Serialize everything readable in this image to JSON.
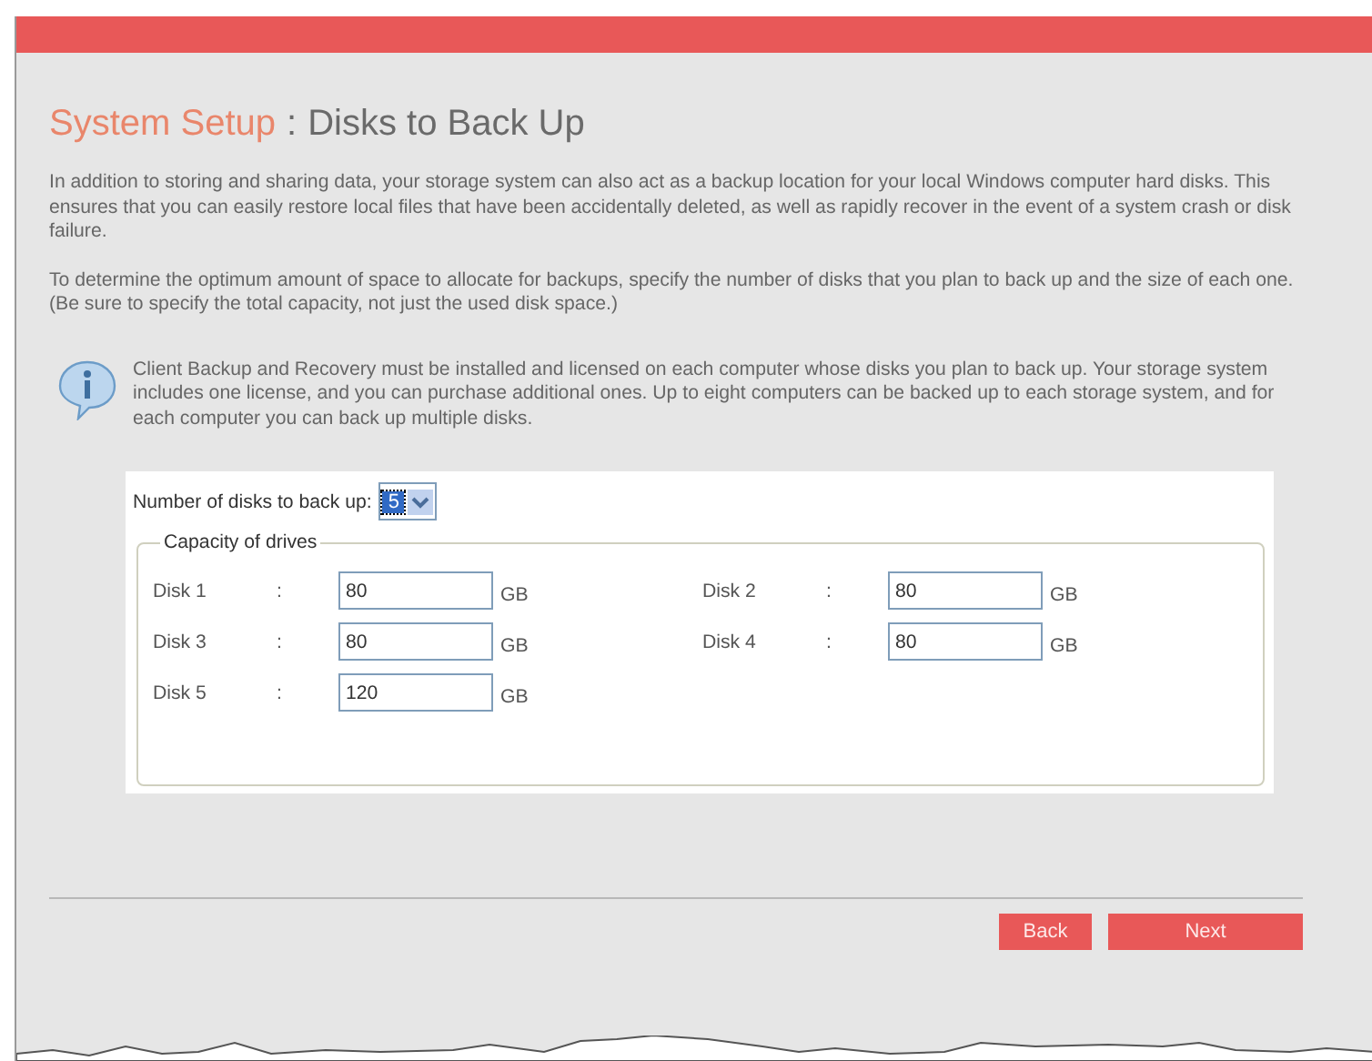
{
  "header": {
    "title_prefix": "System Setup",
    "title_separator": ":",
    "title": "Disks to Back Up"
  },
  "paragraphs": [
    "In addition to storing and sharing data, your storage system can also act as a backup location for your local Windows computer hard disks. This ensures that you can easily restore local files that have been accidentally deleted, as well as rapidly recover in the event of a system crash or disk failure.",
    "To determine the optimum amount of space to allocate for backups, specify the number of disks that you plan to back up and the size of each one. (Be sure to specify the total capacity, not just the used disk space.)"
  ],
  "info_note": "Client Backup and Recovery must be installed and licensed on each computer whose disks you plan to back up. Your storage system includes one license, and you can purchase additional ones. Up to eight computers can be backed up to each storage system, and for each computer you can back up multiple disks.",
  "disk_count": {
    "label": "Number of disks to back up:",
    "value": "5"
  },
  "capacity": {
    "legend": "Capacity of drives",
    "disks": [
      {
        "label": "Disk 1",
        "separator": ":",
        "value": "80",
        "unit": "GB"
      },
      {
        "label": "Disk 2",
        "separator": ":",
        "value": "80",
        "unit": "GB"
      },
      {
        "label": "Disk 3",
        "separator": ":",
        "value": "80",
        "unit": "GB"
      },
      {
        "label": "Disk 4",
        "separator": ":",
        "value": "80",
        "unit": "GB"
      },
      {
        "label": "Disk 5",
        "separator": ":",
        "value": "120",
        "unit": "GB"
      }
    ]
  },
  "buttons": [
    "Back",
    "Next"
  ]
}
